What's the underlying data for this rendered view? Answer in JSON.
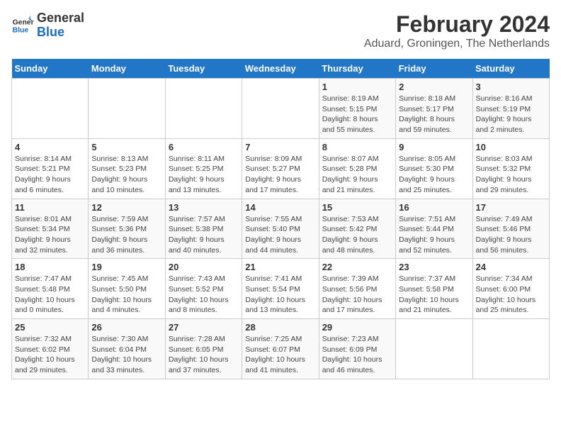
{
  "header": {
    "logo_line1": "General",
    "logo_line2": "Blue",
    "title": "February 2024",
    "subtitle": "Aduard, Groningen, The Netherlands"
  },
  "columns": [
    "Sunday",
    "Monday",
    "Tuesday",
    "Wednesday",
    "Thursday",
    "Friday",
    "Saturday"
  ],
  "weeks": [
    [
      {
        "day": "",
        "info": ""
      },
      {
        "day": "",
        "info": ""
      },
      {
        "day": "",
        "info": ""
      },
      {
        "day": "",
        "info": ""
      },
      {
        "day": "1",
        "info": "Sunrise: 8:19 AM\nSunset: 5:15 PM\nDaylight: 8 hours\nand 55 minutes."
      },
      {
        "day": "2",
        "info": "Sunrise: 8:18 AM\nSunset: 5:17 PM\nDaylight: 8 hours\nand 59 minutes."
      },
      {
        "day": "3",
        "info": "Sunrise: 8:16 AM\nSunset: 5:19 PM\nDaylight: 9 hours\nand 2 minutes."
      }
    ],
    [
      {
        "day": "4",
        "info": "Sunrise: 8:14 AM\nSunset: 5:21 PM\nDaylight: 9 hours\nand 6 minutes."
      },
      {
        "day": "5",
        "info": "Sunrise: 8:13 AM\nSunset: 5:23 PM\nDaylight: 9 hours\nand 10 minutes."
      },
      {
        "day": "6",
        "info": "Sunrise: 8:11 AM\nSunset: 5:25 PM\nDaylight: 9 hours\nand 13 minutes."
      },
      {
        "day": "7",
        "info": "Sunrise: 8:09 AM\nSunset: 5:27 PM\nDaylight: 9 hours\nand 17 minutes."
      },
      {
        "day": "8",
        "info": "Sunrise: 8:07 AM\nSunset: 5:28 PM\nDaylight: 9 hours\nand 21 minutes."
      },
      {
        "day": "9",
        "info": "Sunrise: 8:05 AM\nSunset: 5:30 PM\nDaylight: 9 hours\nand 25 minutes."
      },
      {
        "day": "10",
        "info": "Sunrise: 8:03 AM\nSunset: 5:32 PM\nDaylight: 9 hours\nand 29 minutes."
      }
    ],
    [
      {
        "day": "11",
        "info": "Sunrise: 8:01 AM\nSunset: 5:34 PM\nDaylight: 9 hours\nand 32 minutes."
      },
      {
        "day": "12",
        "info": "Sunrise: 7:59 AM\nSunset: 5:36 PM\nDaylight: 9 hours\nand 36 minutes."
      },
      {
        "day": "13",
        "info": "Sunrise: 7:57 AM\nSunset: 5:38 PM\nDaylight: 9 hours\nand 40 minutes."
      },
      {
        "day": "14",
        "info": "Sunrise: 7:55 AM\nSunset: 5:40 PM\nDaylight: 9 hours\nand 44 minutes."
      },
      {
        "day": "15",
        "info": "Sunrise: 7:53 AM\nSunset: 5:42 PM\nDaylight: 9 hours\nand 48 minutes."
      },
      {
        "day": "16",
        "info": "Sunrise: 7:51 AM\nSunset: 5:44 PM\nDaylight: 9 hours\nand 52 minutes."
      },
      {
        "day": "17",
        "info": "Sunrise: 7:49 AM\nSunset: 5:46 PM\nDaylight: 9 hours\nand 56 minutes."
      }
    ],
    [
      {
        "day": "18",
        "info": "Sunrise: 7:47 AM\nSunset: 5:48 PM\nDaylight: 10 hours\nand 0 minutes."
      },
      {
        "day": "19",
        "info": "Sunrise: 7:45 AM\nSunset: 5:50 PM\nDaylight: 10 hours\nand 4 minutes."
      },
      {
        "day": "20",
        "info": "Sunrise: 7:43 AM\nSunset: 5:52 PM\nDaylight: 10 hours\nand 8 minutes."
      },
      {
        "day": "21",
        "info": "Sunrise: 7:41 AM\nSunset: 5:54 PM\nDaylight: 10 hours\nand 13 minutes."
      },
      {
        "day": "22",
        "info": "Sunrise: 7:39 AM\nSunset: 5:56 PM\nDaylight: 10 hours\nand 17 minutes."
      },
      {
        "day": "23",
        "info": "Sunrise: 7:37 AM\nSunset: 5:58 PM\nDaylight: 10 hours\nand 21 minutes."
      },
      {
        "day": "24",
        "info": "Sunrise: 7:34 AM\nSunset: 6:00 PM\nDaylight: 10 hours\nand 25 minutes."
      }
    ],
    [
      {
        "day": "25",
        "info": "Sunrise: 7:32 AM\nSunset: 6:02 PM\nDaylight: 10 hours\nand 29 minutes."
      },
      {
        "day": "26",
        "info": "Sunrise: 7:30 AM\nSunset: 6:04 PM\nDaylight: 10 hours\nand 33 minutes."
      },
      {
        "day": "27",
        "info": "Sunrise: 7:28 AM\nSunset: 6:05 PM\nDaylight: 10 hours\nand 37 minutes."
      },
      {
        "day": "28",
        "info": "Sunrise: 7:25 AM\nSunset: 6:07 PM\nDaylight: 10 hours\nand 41 minutes."
      },
      {
        "day": "29",
        "info": "Sunrise: 7:23 AM\nSunset: 6:09 PM\nDaylight: 10 hours\nand 46 minutes."
      },
      {
        "day": "",
        "info": ""
      },
      {
        "day": "",
        "info": ""
      }
    ]
  ]
}
